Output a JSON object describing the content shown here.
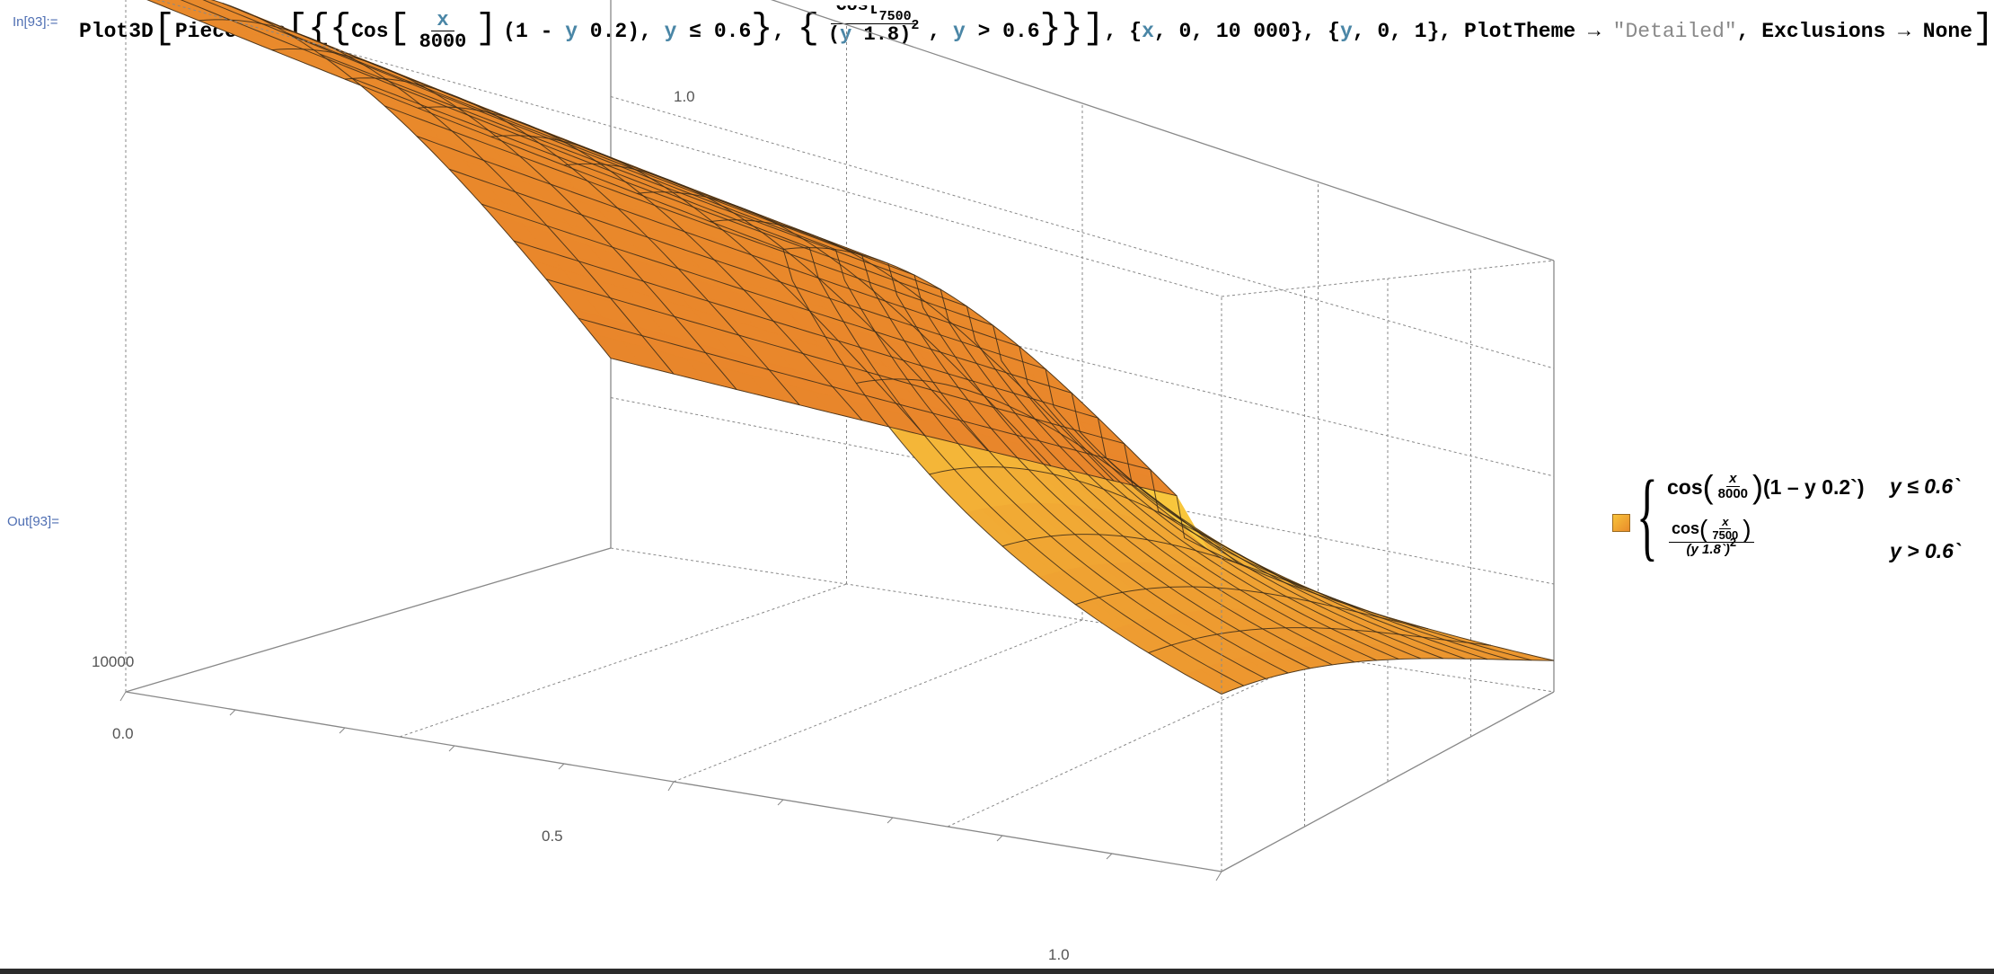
{
  "input_cell": {
    "label": "In[93]:=",
    "head": "Plot3D",
    "piecewise": "Piecewise",
    "cos1": "Cos",
    "frac1_num": "x",
    "frac1_den": "8000",
    "factor_pre": "(1 - ",
    "factor_var": "y",
    "factor_post": " 0.2)",
    "cond1_var": "y",
    "cond1_rest": " ≤ 0.6",
    "frac2_num_top": "Cos[",
    "frac2_num_sub": "7500",
    "frac2_den_pre": "(",
    "frac2_den_var": "y",
    "frac2_den_post": " 1.8)",
    "frac2_den_exp": "2",
    "cond2_var": "y",
    "cond2_rest": " > 0.6",
    "range_x_pre": "{",
    "range_x_var": "x",
    "range_x_rest": ", 0, 10 000}",
    "range_y_pre": "{",
    "range_y_var": "y",
    "range_y_rest": ", 0, 1}",
    "opt1_name": "PlotTheme",
    "opt1_value": "\"Detailed\"",
    "opt2_name": "Exclusions",
    "opt2_value": "None",
    "arrow": "→"
  },
  "output_cell": {
    "label": "Out[93]="
  },
  "plot": {
    "type": "surface3d",
    "function": "Piecewise: cos(x/8000)(1 - 0.2 y) for y ≤ 0.6; cos(x/7500)/(1.8 y)^2 for y > 0.6",
    "x_range": [
      0,
      10000
    ],
    "y_range": [
      0,
      1
    ],
    "surface_color_light": "#f8c63c",
    "surface_color_dark": "#e8842a",
    "mesh_color": "#3a2a18",
    "box_color": "#888888",
    "tick_labels": {
      "y_axis": [
        "0.0",
        "0.5",
        "1.0"
      ],
      "x_axis": [
        "10000"
      ],
      "z_axis": [
        "1.0"
      ]
    }
  },
  "legend": {
    "row1_cos": "cos",
    "row1_frac_num": "x",
    "row1_frac_den": "8000",
    "row1_factor": "(1 – y 0.2`)",
    "row1_condition": "y ≤ 0.6`",
    "row2_cos": "cos",
    "row2_frac_num": "x",
    "row2_frac_den": "7500",
    "row2_den_base": "(y 1.8`)",
    "row2_den_exp": "2",
    "row2_condition": "y > 0.6`"
  }
}
